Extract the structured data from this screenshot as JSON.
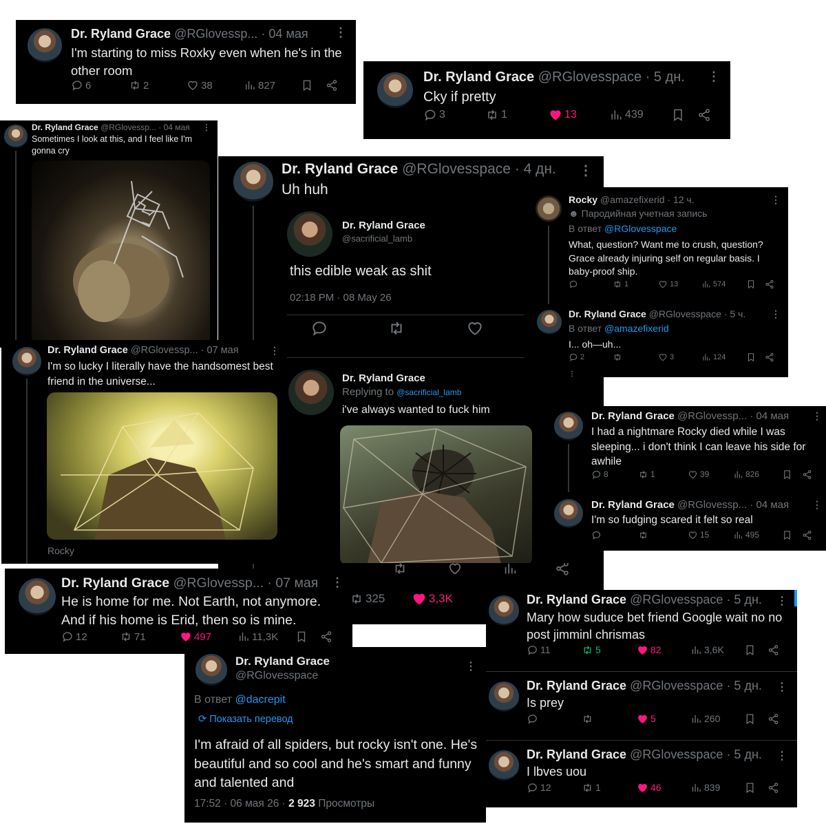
{
  "t1": {
    "name": "Dr. Ryland Grace",
    "handle": "@RGlovessp...",
    "time": "· 04 мая",
    "text": "I'm starting to miss Roxky even when he's in the other room",
    "replies": "6",
    "reposts": "2",
    "likes": "38",
    "views": "827"
  },
  "t2": {
    "name": "Dr. Ryland Grace",
    "handle": "@RGlovesspace",
    "time": "· 5 дн.",
    "text": "Cky if pretty",
    "replies": "3",
    "reposts": "1",
    "likes": "13",
    "views": "439"
  },
  "t3": {
    "name": "Dr. Ryland Grace",
    "handle": "@RGlovessp...",
    "time": "· 04 мая",
    "text": "Sometimes I look at this, and I feel like I'm gonna cry"
  },
  "t4": {
    "name": "Dr. Ryland Grace",
    "handle": "@RGlovesspace",
    "time": "· 4 дн.",
    "text": "Uh huh",
    "quote": {
      "name": "Dr. Ryland Grace",
      "handle": "@sacrificial_lamb",
      "text": "this edible weak as shit",
      "meta": "02:18 PM · 08 May 26"
    },
    "reply": {
      "name": "Dr. Ryland Grace",
      "replying_prefix": "Replying to",
      "replying_handle": "@sacrificial_lamb",
      "text": "i've always wanted to fuck him"
    }
  },
  "t5": {
    "name": "Rocky",
    "handle": "@amazefixerid",
    "time": "· 12 ч.",
    "parody": "Пародийная учетная запись",
    "reply_prefix": "В ответ",
    "reply_handle": "@RGlovesspace",
    "text": "What, question? Want me to crush, question? Grace already injuring self on regular basis. I baby-proof ship.",
    "reposts": "1",
    "likes": "13",
    "views": "574"
  },
  "t6": {
    "name": "Dr. Ryland Grace",
    "handle": "@RGlovesspace",
    "time": "· 5 ч.",
    "reply_prefix": "В ответ",
    "reply_handle": "@amazefixerid",
    "text": "I... oh—uh...",
    "replies": "2",
    "likes": "3",
    "views": "124"
  },
  "t7": {
    "name": "Dr. Ryland Grace",
    "handle": "@RGlovessp...",
    "time": "· 07 мая",
    "text": "I'm so lucky I literally have the handsomest best friend in the universe...",
    "caption": "Rocky"
  },
  "t8": {
    "name": "Dr. Ryland Grace",
    "handle": "@RGlovessp...",
    "time": "· 04 мая",
    "text": "I had a nightmare Rocky died while I was sleeping... i don't think I can leave his side for awhile",
    "replies": "8",
    "reposts": "1",
    "likes": "39",
    "views": "826"
  },
  "t9": {
    "name": "Dr. Ryland Grace",
    "handle": "@RGlovessp...",
    "time": "· 04 мая",
    "text": "I'm so fudging scared it felt so real",
    "likes": "15",
    "views": "495"
  },
  "t10": {
    "name": "Dr. Ryland Grace",
    "handle": "@RGlovessp...",
    "time": "· 07 мая",
    "text": "He is home for me. Not Earth, not anymore. And if his home is Erid, then so is mine.",
    "replies": "12",
    "reposts": "71",
    "likes": "497",
    "views": "11,3K"
  },
  "t11": {
    "reposts": "325",
    "likes": "3,3K"
  },
  "t12": {
    "name": "Dr. Ryland Grace",
    "handle": "@RGlovesspace",
    "reply_prefix": "В ответ",
    "reply_handle": "@dacrepit",
    "translate": "Показать перевод",
    "text": "I'm afraid of all spiders, but rocky isn't one. He's beautiful and so cool and he's smart and funny and talented and",
    "meta": "17:52 · 06 мая 26 ·",
    "views_count": "2 923",
    "views_label": "Просмотры"
  },
  "t13": {
    "name": "Dr. Ryland Grace",
    "handle": "@RGlovesspace",
    "time": "· 5 дн.",
    "text": "Mary how suduce bet friend Google wait no no post jimminl chrismas",
    "replies": "11",
    "reposts": "5",
    "likes": "82",
    "views": "3,6K"
  },
  "t14": {
    "name": "Dr. Ryland Grace",
    "handle": "@RGlovesspace",
    "time": "· 5 дн.",
    "text": "Is prey",
    "likes": "5",
    "views": "260"
  },
  "t15": {
    "name": "Dr. Ryland Grace",
    "handle": "@RGlovesspace",
    "time": "· 5 дн.",
    "text": "I lbves uou",
    "replies": "12",
    "reposts": "1",
    "likes": "46",
    "views": "839"
  },
  "colors": {
    "background": "#000000",
    "text": "#e7e9ea",
    "muted": "#71767b",
    "link": "#1d9bf0",
    "like": "#f91880",
    "repost": "#00ba7c"
  }
}
